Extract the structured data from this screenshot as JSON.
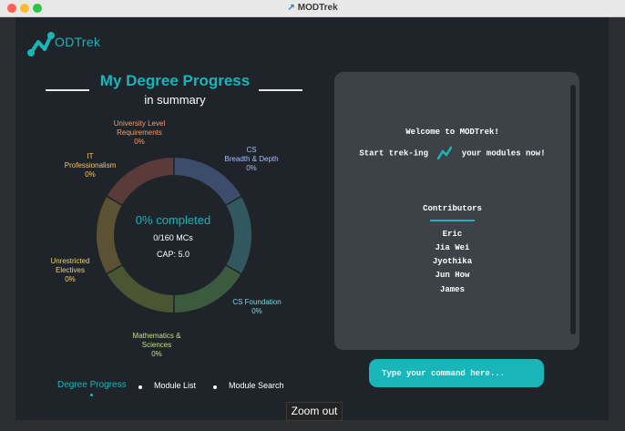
{
  "window": {
    "title": "MODTrek"
  },
  "logo": {
    "text": "ODTrek"
  },
  "progress": {
    "title": "My Degree Progress",
    "subtitle": "in summary",
    "percent_text": "0% completed",
    "mcs_text": "0/160 MCs",
    "cap_text": "CAP: 5.0",
    "segments": [
      {
        "name_lines": [
          "CS",
          "Breadth & Depth"
        ],
        "percent": "0%",
        "value": 0,
        "color": "#3d4c6b",
        "label_color": "#a8bcff"
      },
      {
        "name_lines": [
          "CS Foundation"
        ],
        "percent": "0%",
        "value": 0,
        "color": "#31585f",
        "label_color": "#7ad7e0"
      },
      {
        "name_lines": [
          "Mathematics &",
          "Sciences"
        ],
        "percent": "0%",
        "value": 0,
        "color": "#3c5a3e",
        "label_color": "#bfe07a"
      },
      {
        "name_lines": [
          "Unrestricted",
          "Electives"
        ],
        "percent": "0%",
        "value": 0,
        "color": "#4b5532",
        "label_color": "#e8d36a"
      },
      {
        "name_lines": [
          "IT",
          "Professionalism"
        ],
        "percent": "0%",
        "value": 0,
        "color": "#5b5234",
        "label_color": "#f2c56a"
      },
      {
        "name_lines": [
          "University Level",
          "Requirements"
        ],
        "percent": "0%",
        "value": 0,
        "color": "#5a3b39",
        "label_color": "#f59a6d"
      }
    ]
  },
  "console": {
    "welcome": "Welcome to MODTrek!",
    "start_prefix": "Start trek-ing",
    "start_suffix": "your modules now!",
    "contributors_title": "Contributors",
    "contributors": [
      "Eric",
      "Jia Wei",
      "Jyothika",
      "Jun How",
      "James"
    ]
  },
  "command": {
    "placeholder": "Type your command here..."
  },
  "nav": {
    "tabs": [
      "Degree Progress",
      "Module List",
      "Module Search"
    ],
    "active": "Degree Progress"
  },
  "tooltip": {
    "text": "Zoom out"
  },
  "colors": {
    "accent": "#19b5b9",
    "background": "#1f242b",
    "panel": "#3d4249"
  }
}
